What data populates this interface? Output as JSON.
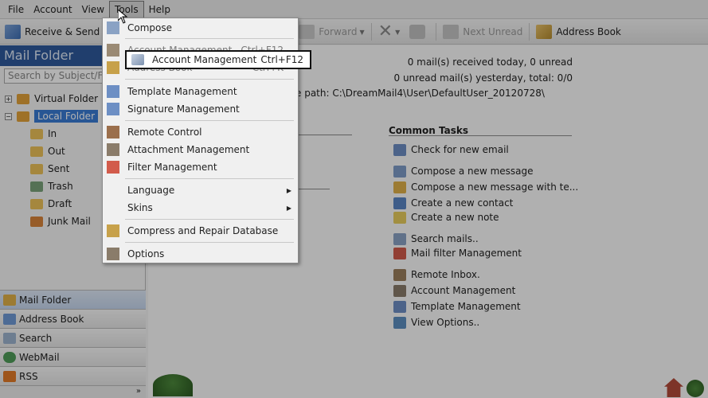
{
  "menubar": [
    "File",
    "Account",
    "View",
    "Tools",
    "Help"
  ],
  "toolbar": {
    "receive_send": "Receive & Send",
    "forward": "Forward",
    "next_unread": "Next Unread",
    "address_book": "Address Book"
  },
  "left": {
    "header": "Mail Folder",
    "search_placeholder": "Search by Subject/F",
    "virtual_folder": "Virtual Folder",
    "local_folder": "Local Folder",
    "folders": [
      "In",
      "Out",
      "Sent",
      "Trash",
      "Draft",
      "Junk Mail"
    ],
    "nav": [
      "Mail Folder",
      "Address Book",
      "Search",
      "WebMail",
      "RSS"
    ],
    "expand_glyph": "»"
  },
  "main": {
    "stat_today": "0 mail(s) received today, 0 unread",
    "stat_yesterday": "0 unread mail(s) yesterday, total: 0/0",
    "storage_path": "e path: C:\\DreamMail4\\User\\DefaultUser_20120728\\",
    "common_tasks_title": "Common Tasks",
    "tasks": [
      "Check for new email",
      "Compose a new message",
      "Compose a new message with te...",
      "Create a new contact",
      "Create a new note",
      "Search mails..",
      "Mail filter Management",
      "Remote Inbox.",
      "Account Management",
      "Template Management",
      "View Options.."
    ]
  },
  "tools_menu": {
    "compose": "Compose",
    "account_mgmt": "Account Management",
    "account_mgmt_shortcut": "Ctrl+F12",
    "address_book": "Address Book",
    "address_book_shortcut": "Ctrl+K",
    "template_mgmt": "Template Management",
    "signature_mgmt": "Signature Management",
    "remote_control": "Remote Control",
    "attachment_mgmt": "Attachment Management",
    "filter_mgmt": "Filter Management",
    "language": "Language",
    "skins": "Skins",
    "compress": "Compress and Repair Database",
    "options": "Options",
    "submenu_arrow": "▶"
  },
  "colors": {
    "accent": "#2f5a9c",
    "selection": "#3a7bd5"
  }
}
